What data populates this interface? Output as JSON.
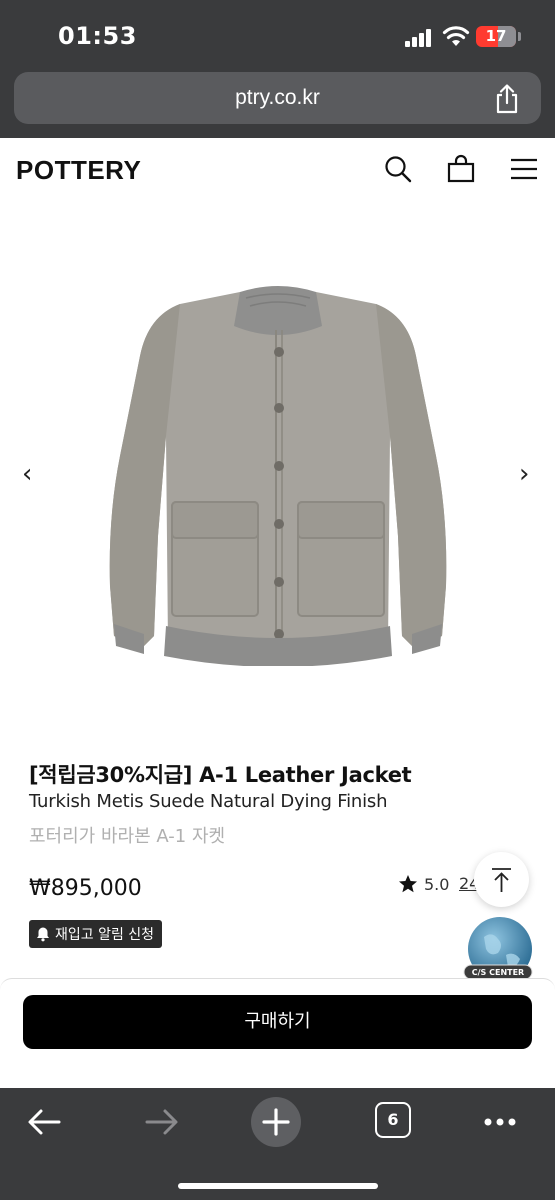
{
  "status_bar": {
    "time": "01:53",
    "battery_level": "17",
    "icons": [
      "cellular-signal-icon",
      "wifi-icon",
      "battery-icon"
    ]
  },
  "browser": {
    "url": "ptry.co.kr",
    "share_icon": "share-icon"
  },
  "header": {
    "logo": "POTTERY",
    "icons": [
      "search-icon",
      "shopping-bag-icon",
      "menu-icon"
    ]
  },
  "gallery": {
    "prev_label": "‹",
    "next_label": "›",
    "image": "grey suede A-1 jacket product photo"
  },
  "product": {
    "title": "[적립금30%지급] A-1 Leather Jacket",
    "subtitle": "Turkish Metis Suede Natural Dying Finish",
    "korean_subtitle": "포터리가 바라본 A-1 자켓",
    "price": "₩895,000",
    "rating": "5.0",
    "review_count": "24",
    "restock_label": "재입고 알림 신청"
  },
  "floating": {
    "cs_center_label": "C/S CENTER"
  },
  "purchase": {
    "buy_label": "구매하기"
  },
  "toolbar": {
    "tab_count": "6",
    "icons": [
      "back-icon",
      "forward-icon",
      "new-tab-icon",
      "tabs-icon",
      "more-icon"
    ]
  },
  "colors": {
    "chrome": "#3a3b3d",
    "battery_low": "#ff3b30",
    "button": "#000000",
    "muted_text": "#b0b0b0"
  }
}
